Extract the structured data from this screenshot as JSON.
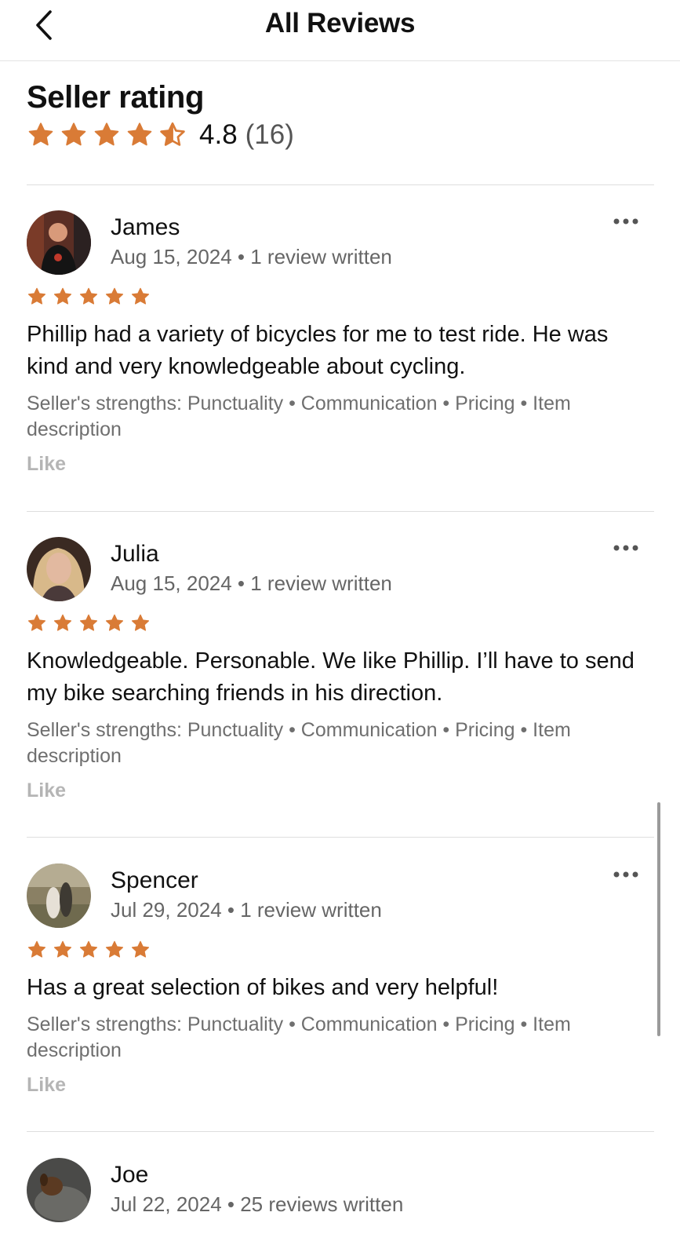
{
  "header": {
    "title": "All Reviews",
    "back_icon": "chevron-left-icon"
  },
  "seller_rating": {
    "title": "Seller rating",
    "score": "4.8",
    "count": "(16)",
    "stars": 4.5,
    "star_color": "#D97B36"
  },
  "reviews": [
    {
      "name": "James",
      "meta": "Aug 15, 2024 • 1 review written",
      "stars": 5,
      "text": "Phillip had a variety of bicycles for me to test ride. He was kind and very knowledgeable about cycling.",
      "strengths": "Seller's strengths: Punctuality • Communication • Pricing • Item description",
      "like": "Like"
    },
    {
      "name": "Julia",
      "meta": "Aug 15, 2024 • 1 review written",
      "stars": 5,
      "text": "Knowledgeable. Personable. We like Phillip. I’ll have to send my bike searching friends in his direction.",
      "strengths": "Seller's strengths: Punctuality • Communication • Pricing • Item description",
      "like": "Like"
    },
    {
      "name": "Spencer",
      "meta": "Jul 29, 2024 • 1 review written",
      "stars": 5,
      "text": "Has a great selection of bikes and very helpful!",
      "strengths": "Seller's strengths: Punctuality • Communication • Pricing • Item description",
      "like": "Like"
    },
    {
      "name": "Joe",
      "meta": "Jul 22, 2024 • 25 reviews written"
    }
  ],
  "icons": {
    "more": "more-horizontal-icon",
    "star": "star-icon",
    "half_star": "star-half-icon"
  },
  "colors": {
    "accent": "#D97B36",
    "secondary_text": "#666666",
    "divider": "#DEDEDE",
    "like": "#B5B5B5"
  }
}
